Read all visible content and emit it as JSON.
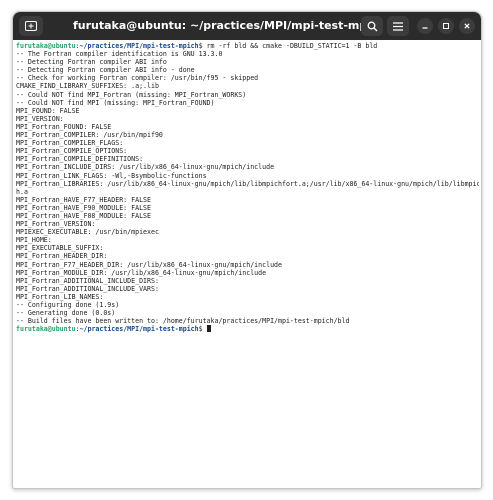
{
  "window": {
    "title": "furutaka@ubuntu: ~/practices/MPI/mpi-test-mpich",
    "new_tab_icon": "new-tab-icon",
    "search_icon": "search-icon",
    "menu_icon": "hamburger-menu-icon",
    "controls": [
      "minimize-icon",
      "maximize-icon",
      "close-icon"
    ]
  },
  "colors": {
    "titlebar": "#2b2b2b",
    "prompt_user": "#26a269",
    "prompt_path": "#12488b",
    "text": "#1e1e1e",
    "background": "#ffffff"
  },
  "terminal": {
    "prompt1": {
      "user": "furutaka@ubuntu",
      "sep": ":",
      "path": "~/practices/MPI/mpi-test-mpich",
      "sigil": "$ ",
      "command": "rm -rf bld && cmake -DBUILD_STATIC=1 -B bld"
    },
    "output": [
      "-- The Fortran compiler identification is GNU 13.3.0",
      "-- Detecting Fortran compiler ABI info",
      "-- Detecting Fortran compiler ABI info - done",
      "-- Check for working Fortran compiler: /usr/bin/f95 - skipped",
      "CMAKE_FIND_LIBRARY_SUFFIXES: .a;.lib",
      "-- Could NOT find MPI_Fortran (missing: MPI_Fortran_WORKS)",
      "-- Could NOT find MPI (missing: MPI_Fortran_FOUND)",
      "MPI_FOUND: FALSE",
      "MPI_VERSION:",
      "MPI_Fortran_FOUND: FALSE",
      "MPI_Fortran_COMPILER: /usr/bin/mpif90",
      "MPI_Fortran_COMPILER_FLAGS:",
      "MPI_Fortran_COMPILE_OPTIONS:",
      "MPI_Fortran_COMPILE_DEFINITIONS:",
      "MPI_Fortran_INCLUDE_DIRS: /usr/lib/x86_64-linux-gnu/mpich/include",
      "MPI_Fortran_LINK_FLAGS: -Wl,-Bsymbolic-functions",
      "MPI_Fortran_LIBRARIES: /usr/lib/x86_64-linux-gnu/mpich/lib/libmpichfort.a;/usr/lib/x86_64-linux-gnu/mpich/lib/libmpic",
      "h.a",
      "MPI_Fortran_HAVE_F77_HEADER: FALSE",
      "MPI_Fortran_HAVE_F90_MODULE: FALSE",
      "MPI_Fortran_HAVE_F08_MODULE: FALSE",
      "MPI_Fortran_VERSION:",
      "MPIEXEC_EXECUTABLE: /usr/bin/mpiexec",
      "MPI_HOME:",
      "MPI_EXECUTABLE_SUFFIX:",
      "MPI_Fortran_HEADER_DIR:",
      "MPI_Fortran_F77_HEADER_DIR: /usr/lib/x86_64-linux-gnu/mpich/include",
      "MPI_Fortran_MODULE_DIR: /usr/lib/x86_64-linux-gnu/mpich/include",
      "MPI_Fortran_ADDITIONAL_INCLUDE_DIRS:",
      "MPI_Fortran_ADDITIONAL_INCLUDE_VARS:",
      "MPI_Fortran_LIB_NAMES:",
      "-- Configuring done (1.9s)",
      "-- Generating done (0.0s)",
      "-- Build files have been written to: /home/furutaka/practices/MPI/mpi-test-mpich/bld"
    ],
    "prompt2": {
      "user": "furutaka@ubuntu",
      "sep": ":",
      "path": "~/practices/MPI/mpi-test-mpich",
      "sigil": "$ "
    }
  }
}
